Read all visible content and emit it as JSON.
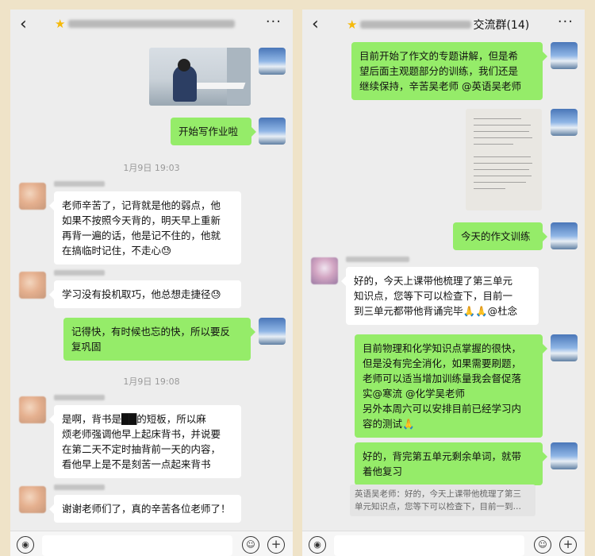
{
  "left": {
    "messages": [
      {
        "text": "开始写作业啦"
      },
      {
        "text": "老师辛苦了，记背就是他的弱点，他\n如果不按照今天背的，明天早上重新\n再背一遍的话，他是记不住的，他就\n在搞临时记住，不走心😓"
      },
      {
        "text": "学习没有投机取巧，他总想走捷径😓"
      },
      {
        "text": "记得快，有时候也忘的快，所以要反\n复巩固"
      },
      {
        "text": "是啊，背书是██的短板，所以麻\n烦老师强调他早上起床背书，并说要\n在第二天不定时抽背前一天的内容，\n看他早上是不是刻苦一点起来背书"
      },
      {
        "text": "谢谢老师们了，真的辛苦各位老师了！"
      }
    ],
    "times": [
      "1月9日 19:03",
      "1月9日 19:08"
    ]
  },
  "right": {
    "title_suffix": "交流群(14)",
    "messages": [
      {
        "text": "目前开始了作文的专题讲解，但是希\n望后面主观题部分的训练，我们还是\n继续保持，辛苦吴老师 @英语吴老师"
      },
      {
        "text": "今天的作文训练"
      },
      {
        "text": "好的，今天上课带他梳理了第三单元\n知识点，您等下可以检查下，目前一\n到三单元都带他背诵完毕🙏🙏@杜念"
      },
      {
        "text": "目前物理和化学知识点掌握的很快，\n但是没有完全消化，如果需要刷题，\n老师可以适当增加训练量我会督促落\n实@寒流 @化学吴老师\n另外本周六可以安排目前已经学习内\n容的测试🙏"
      },
      {
        "text": "好的，背完第五单元剩余单词，就带\n着他复习"
      }
    ],
    "quote": "英语吴老师：好的，今天上课带他梳理了第三\n单元知识点，您等下可以检查下，目前一到…"
  },
  "icons": {
    "back": "‹",
    "more": "···",
    "voice": "◉",
    "emoji": "☺",
    "plus": "+"
  }
}
